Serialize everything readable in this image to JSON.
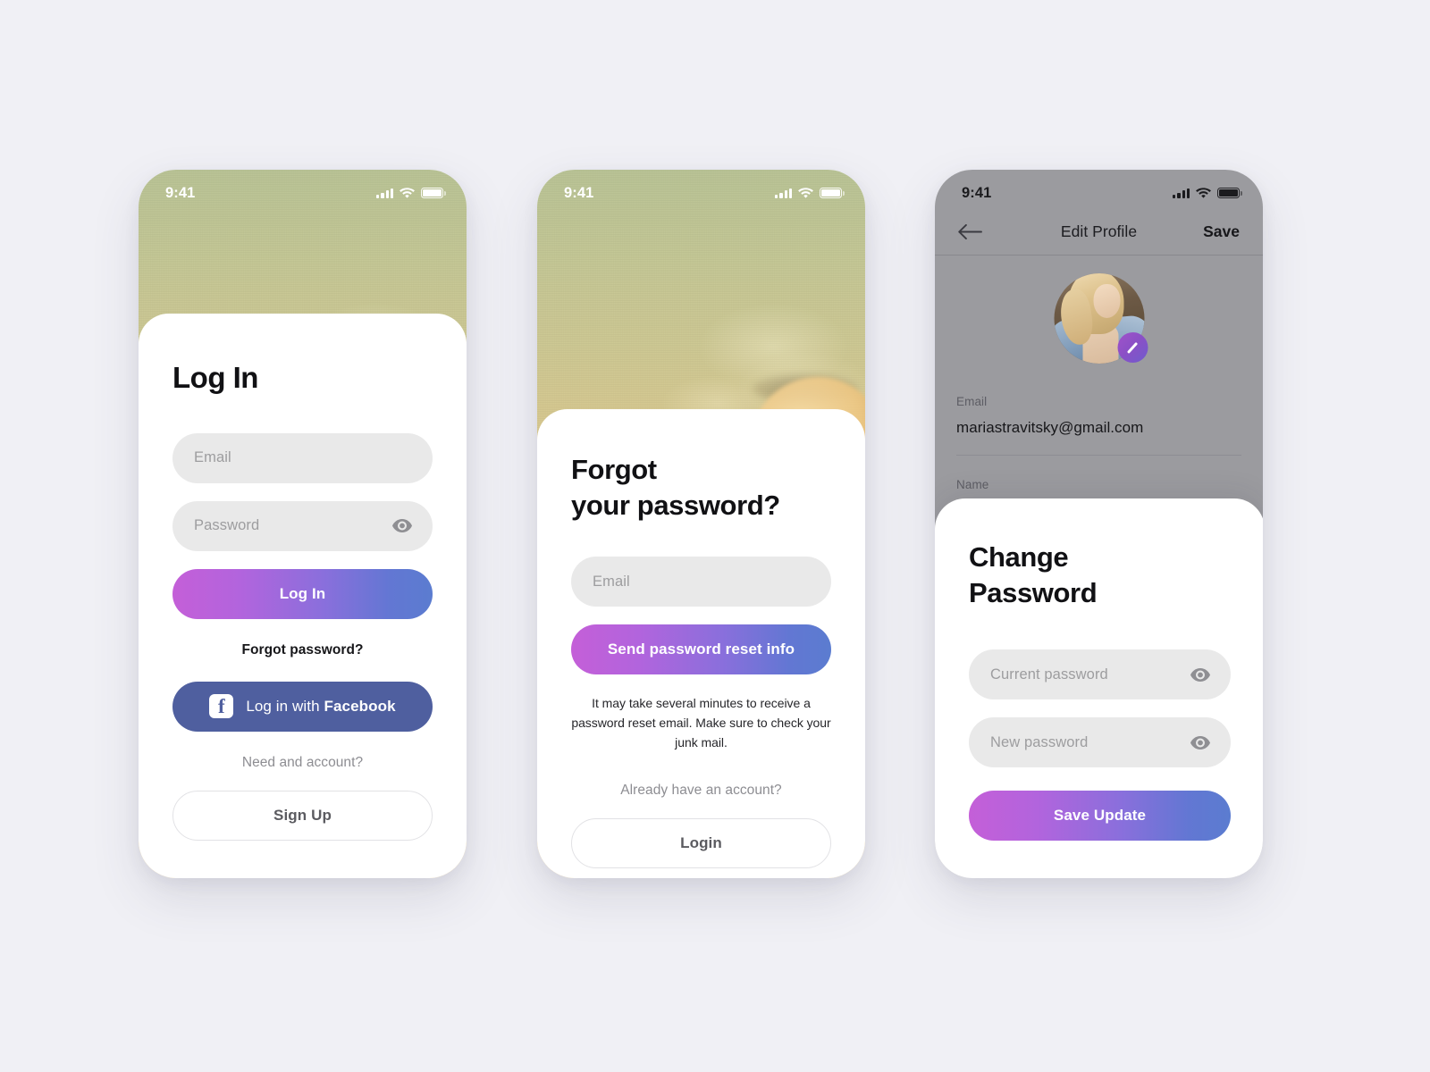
{
  "meta": {
    "page_background": "#f0f0f5",
    "gradient_start": "#c45fd8",
    "gradient_end": "#5b7cd0",
    "facebook_blue": "#4f5f9f",
    "input_grey": "#e9e9e9",
    "dim_overlay": "#9b9b9f"
  },
  "screen_login": {
    "status": {
      "time": "9:41"
    },
    "title": "Log In",
    "email_placeholder": "Email",
    "password_placeholder": "Password",
    "login_button": "Log In",
    "forgot_link": "Forgot password?",
    "facebook_button_prefix": "Log in with ",
    "facebook_button_brand": "Facebook",
    "need_account_text": "Need and account?",
    "signup_button": "Sign Up"
  },
  "screen_forgot": {
    "status": {
      "time": "9:41"
    },
    "title_line1": "Forgot",
    "title_line2": "your password?",
    "email_placeholder": "Email",
    "send_button": "Send password reset info",
    "helper_text": "It may take several minutes to receive a password reset email. Make sure to check your junk mail.",
    "already_account_text": "Already have an account?",
    "login_button": "Login"
  },
  "screen_edit_profile": {
    "status": {
      "time": "9:41"
    },
    "nav_title": "Edit Profile",
    "nav_save": "Save",
    "email_label": "Email",
    "email_value": "mariastravitsky@gmail.com",
    "name_label": "Name",
    "modal": {
      "title_line1": "Change",
      "title_line2": "Password",
      "current_password_placeholder": "Current password",
      "new_password_placeholder": "New password",
      "save_button": "Save Update"
    }
  }
}
